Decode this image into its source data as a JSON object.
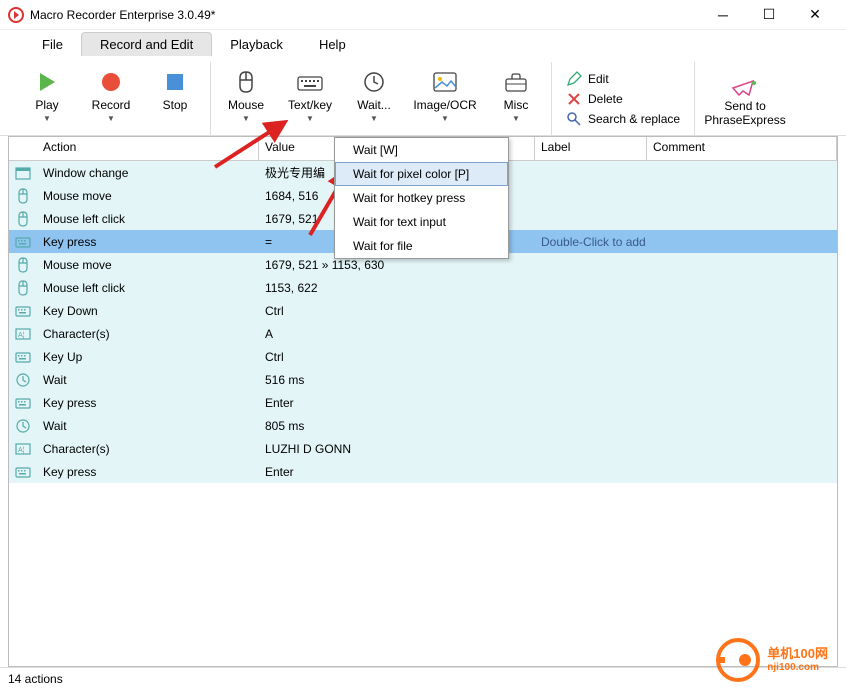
{
  "title": "Macro Recorder Enterprise 3.0.49*",
  "menu": {
    "file": "File",
    "record": "Record and Edit",
    "playback": "Playback",
    "help": "Help"
  },
  "ribbon": {
    "play": "Play",
    "record": "Record",
    "stop": "Stop",
    "mouse": "Mouse",
    "textkey": "Text/key",
    "wait": "Wait...",
    "image": "Image/OCR",
    "misc": "Misc",
    "edit": "Edit",
    "delete": "Delete",
    "search": "Search & replace",
    "sendto": "Send to",
    "phrase": "PhraseExpress"
  },
  "dropdown": [
    "Wait [W]",
    "Wait for pixel color [P]",
    "Wait for hotkey press",
    "Wait for text input",
    "Wait for file"
  ],
  "columns": {
    "action": "Action",
    "value": "Value",
    "label": "Label",
    "comment": "Comment"
  },
  "rows": [
    {
      "icon": "window",
      "action": "Window change",
      "value": "极光专用编"
    },
    {
      "icon": "mouse",
      "action": "Mouse move",
      "value": "1684, 516"
    },
    {
      "icon": "mouse",
      "action": "Mouse left click",
      "value": "1679, 521"
    },
    {
      "icon": "key",
      "action": "Key press",
      "value": "=",
      "label": "Double-Click to add",
      "selected": true
    },
    {
      "icon": "mouse",
      "action": "Mouse move",
      "value": "1679, 521 » 1153, 630"
    },
    {
      "icon": "mouse",
      "action": "Mouse left click",
      "value": "1153, 622"
    },
    {
      "icon": "key",
      "action": "Key Down",
      "value": "Ctrl"
    },
    {
      "icon": "char",
      "action": "Character(s)",
      "value": "A"
    },
    {
      "icon": "key",
      "action": "Key Up",
      "value": "Ctrl"
    },
    {
      "icon": "clock",
      "action": "Wait",
      "value": "516 ms"
    },
    {
      "icon": "key",
      "action": "Key press",
      "value": "Enter"
    },
    {
      "icon": "clock",
      "action": "Wait",
      "value": "805 ms"
    },
    {
      "icon": "char",
      "action": "Character(s)",
      "value": "LUZHI D GONN"
    },
    {
      "icon": "key",
      "action": "Key press",
      "value": "Enter"
    }
  ],
  "status": "14 actions",
  "watermark": {
    "line1": "单机100网",
    "line2": "nji100.com"
  }
}
